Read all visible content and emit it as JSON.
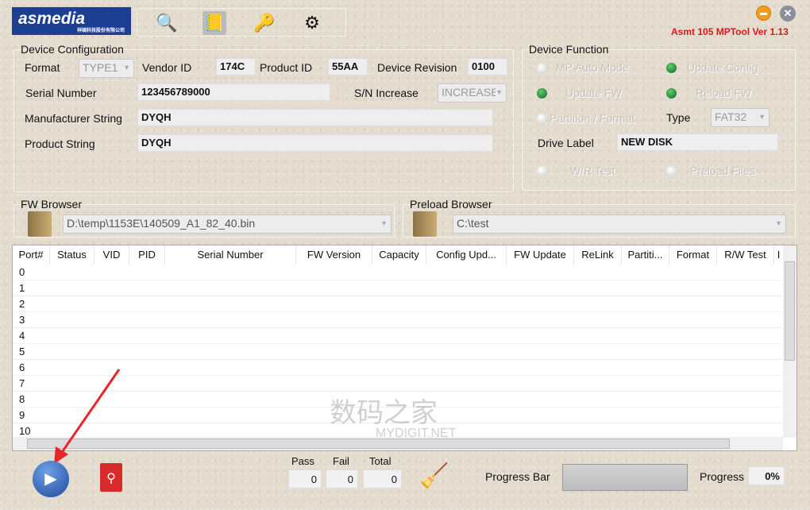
{
  "logo": {
    "brand": "asmedia",
    "subtitle": "祥碩科技股份有限公司"
  },
  "toolbar": {
    "icons": [
      "magnifier-icon",
      "notebook-icon",
      "key-icon",
      "gear-refresh-icon"
    ]
  },
  "window": {
    "version": "Asmt 105 MPTool Ver 1.13",
    "minimize_icon": "minimize-icon",
    "close_icon": "close-icon"
  },
  "device_config": {
    "title": "Device Configuration",
    "format_label": "Format",
    "format_value": "TYPE1",
    "vendor_label": "Vendor ID",
    "vendor_value": "174C",
    "product_label": "Product ID",
    "product_value": "55AA",
    "revision_label": "Device Revision",
    "revision_value": "0100",
    "serial_label": "Serial Number",
    "serial_value": "123456789000",
    "sn_inc_label": "S/N Increase",
    "sn_inc_value": "INCREASE",
    "manufacturer_label": "Manufacturer String",
    "manufacturer_value": "DYQH",
    "product_string_label": "Product String",
    "product_string_value": "DYQH"
  },
  "device_function": {
    "title": "Device Function",
    "mp_auto": "MP Auto Mode",
    "update_config": "Update Config",
    "update_fw": "Update FW",
    "reload_fw": "Reload FW",
    "partition": "Partition / Format",
    "type_label": "Type",
    "type_value": "FAT32",
    "drive_label": "Drive Label",
    "drive_value": "NEW DISK",
    "wr_test": "W/R Test",
    "preload_files": "Preload Files",
    "states": {
      "mp_auto": false,
      "update_config": true,
      "update_fw": true,
      "reload_fw": true,
      "partition": false,
      "wr_test": false,
      "preload_files": false
    }
  },
  "fw_browser": {
    "title": "FW Browser",
    "path": "D:\\temp\\1153E\\140509_A1_82_40.bin"
  },
  "preload_browser": {
    "title": "Preload Browser",
    "path": "C:\\test"
  },
  "table": {
    "columns": [
      "Port#",
      "Status",
      "VID",
      "PID",
      "Serial Number",
      "FW Version",
      "Capacity",
      "Config Upd...",
      "FW Update",
      "ReLink",
      "Partiti...",
      "Format",
      "R/W Test",
      "I"
    ],
    "rows": [
      "0",
      "1",
      "2",
      "3",
      "4",
      "5",
      "6",
      "7",
      "8",
      "9",
      "10"
    ]
  },
  "bottom": {
    "pass_label": "Pass",
    "fail_label": "Fail",
    "total_label": "Total",
    "pass": "0",
    "fail": "0",
    "total": "0",
    "progress_bar_label": "Progress Bar",
    "progress_label": "Progress",
    "progress": "0%",
    "progress_fraction": 0
  },
  "watermark": {
    "cn": "数码之家",
    "en": "MYDIGIT.NET"
  },
  "colors": {
    "version": "#d41a1a",
    "logo_bg": "#1d3f93",
    "radio_on": "#1a7a1a"
  }
}
